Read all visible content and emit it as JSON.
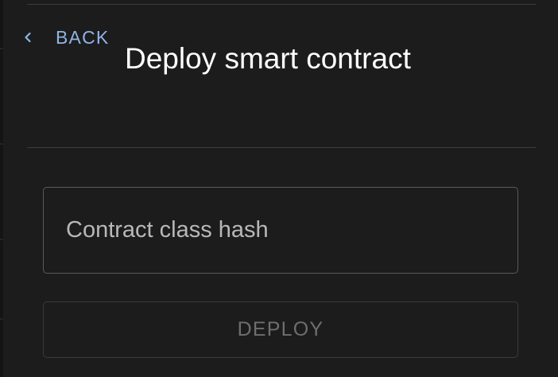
{
  "header": {
    "back_label": "BACK",
    "back_icon": "chevron-left-icon",
    "title": "Deploy smart contract"
  },
  "form": {
    "class_hash": {
      "value": "",
      "placeholder": "Contract class hash"
    },
    "deploy_label": "DEPLOY",
    "deploy_enabled": false
  },
  "colors": {
    "background": "#1c1c1c",
    "accent_link": "#8fb4e6",
    "title_text": "#ffffff",
    "field_border": "#5a5a5a",
    "disabled_text": "#6e6e6e",
    "disabled_border": "#3a3a3a"
  }
}
